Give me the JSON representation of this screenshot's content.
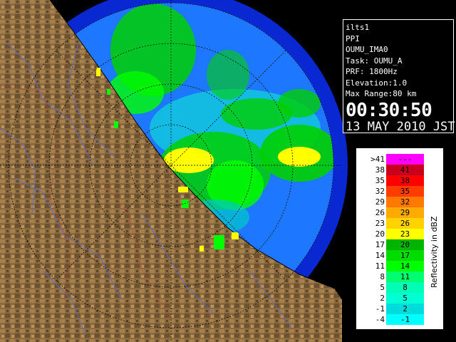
{
  "info": {
    "station": "ilts1",
    "mode": "PPI",
    "site": "OUMU_IMA0",
    "task": "Task: OUMU_A",
    "prf": "PRF: 1800Hz",
    "elevation": "Elevation:1.0",
    "max_range": "Max Range:80 km",
    "time": "00:30:50",
    "date": "13 MAY 2010 JST"
  },
  "legend": {
    "title": "Reflectivity in dBZ",
    "rows": [
      {
        "low": ">41",
        "high": "---",
        "color": "#ff00ff"
      },
      {
        "low": "38",
        "high": "41",
        "color": "#c8001e"
      },
      {
        "low": "35",
        "high": "38",
        "color": "#ff0000"
      },
      {
        "low": "32",
        "high": "35",
        "color": "#ff3c00"
      },
      {
        "low": "29",
        "high": "32",
        "color": "#ff7800"
      },
      {
        "low": "26",
        "high": "29",
        "color": "#ffaa00"
      },
      {
        "low": "23",
        "high": "26",
        "color": "#ffd200"
      },
      {
        "low": "20",
        "high": "23",
        "color": "#ffff00"
      },
      {
        "low": "17",
        "high": "20",
        "color": "#00b400"
      },
      {
        "low": "14",
        "high": "17",
        "color": "#00dc00"
      },
      {
        "low": "11",
        "high": "14",
        "color": "#00ff00"
      },
      {
        "low": "8",
        "high": "11",
        "color": "#00ff6e"
      },
      {
        "low": "5",
        "high": "8",
        "color": "#00ffb4"
      },
      {
        "low": "2",
        "high": "5",
        "color": "#00ffd2"
      },
      {
        "low": "-1",
        "high": "2",
        "color": "#00dcdc"
      },
      {
        "low": "-4",
        "high": "-1",
        "color": "#00ffff"
      }
    ]
  },
  "colors": {
    "range_disk": "#1e78ff",
    "outer_ring": "#0a28d2",
    "land": "#8c6432"
  }
}
